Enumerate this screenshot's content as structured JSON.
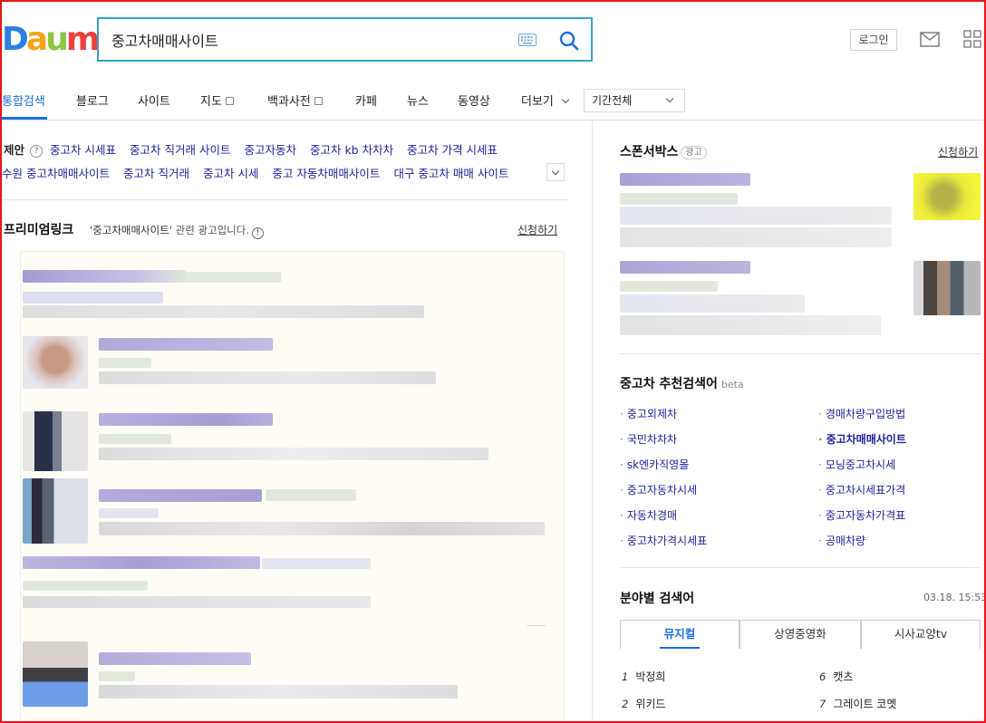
{
  "header": {
    "logo_letters": [
      "D",
      "a",
      "u",
      "m"
    ],
    "search_value": "중고차매매사이트",
    "login_label": "로그인"
  },
  "nav": {
    "items": [
      {
        "label": "통합검색",
        "active": true
      },
      {
        "label": "블로그"
      },
      {
        "label": "사이트"
      },
      {
        "label": "지도"
      },
      {
        "label": "백과사전"
      },
      {
        "label": "카페"
      },
      {
        "label": "뉴스"
      },
      {
        "label": "동영상"
      },
      {
        "label": "더보기"
      }
    ],
    "period_label": "기간전체"
  },
  "suggest": {
    "label": "제안",
    "help": "?",
    "row1": [
      "중고차 시세표",
      "중고차 직거래 사이트",
      "중고자동차",
      "중고차 kb 차차차",
      "중고차 가격 시세표"
    ],
    "row2": [
      "수원 중고차매매사이트",
      "중고차 직거래",
      "중고차 시세",
      "중고 자동차매매사이트",
      "대구 중고차 매매 사이트"
    ]
  },
  "premium": {
    "title": "프리미엄링크",
    "desc_query": "'중고차매매사이트'",
    "desc_suffix": " 관련 광고입니다.",
    "notice": "!",
    "apply_label": "신청하기"
  },
  "sponsor": {
    "title": "스폰서박스",
    "badge": "광고",
    "apply_label": "신청하기"
  },
  "recommend": {
    "title": "중고차 추천검색어",
    "beta": "beta",
    "left": [
      "중고외제차",
      "국민차차차",
      "sk엔카직영몰",
      "중고자동차시세",
      "자동차경매",
      "중고차가격시세표"
    ],
    "right": [
      "경매차량구입방법",
      "중고차매매사이트",
      "모닝중고차시세",
      "중고차시세표가격",
      "중고자동차가격표",
      "공매차량"
    ],
    "highlight": "중고차매매사이트"
  },
  "category": {
    "title": "분야별 검색어",
    "time": "03.18. 15:53",
    "tabs": [
      "뮤지컬",
      "상영중영화",
      "시사교양tv"
    ],
    "active_tab": 0,
    "ranks": [
      {
        "num": "1",
        "label": "박정희"
      },
      {
        "num": "6",
        "label": "캣츠"
      },
      {
        "num": "2",
        "label": "위키드"
      },
      {
        "num": "7",
        "label": "그레이트 코멧"
      }
    ]
  },
  "colors": {
    "accent": "#1a6de0",
    "link": "#20229c",
    "frame": "#e8141b",
    "logo": [
      "#2d7fe3",
      "#f2a51b",
      "#8dc63f",
      "#ef3f3a"
    ]
  }
}
